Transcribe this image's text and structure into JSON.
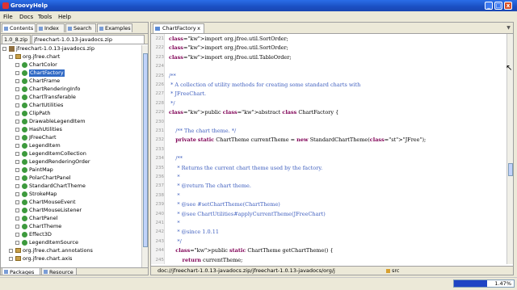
{
  "window": {
    "title": "GroovyHelp",
    "min": "_",
    "max": "□",
    "close": "x"
  },
  "menu": [
    "File",
    "Docs",
    "Tools",
    "Help"
  ],
  "left_tabs": [
    "Contents",
    "Index",
    "Search",
    "Examples"
  ],
  "doc_tabs": [
    "1.0_8.zip",
    "jfreechart-1.0.13-javadocs.zip"
  ],
  "tree": [
    {
      "label": "jfreechart-1.0.13-javadocs.zip",
      "kind": "zip",
      "level": 0
    },
    {
      "label": "org.jfree.chart",
      "kind": "pkg",
      "level": 1
    },
    {
      "label": "ChartColor",
      "kind": "cls",
      "level": 2
    },
    {
      "label": "ChartFactory",
      "kind": "cls",
      "level": 2,
      "selected": true
    },
    {
      "label": "ChartFrame",
      "kind": "cls",
      "level": 2
    },
    {
      "label": "ChartRenderingInfo",
      "kind": "cls",
      "level": 2
    },
    {
      "label": "ChartTransferable",
      "kind": "cls",
      "level": 2
    },
    {
      "label": "ChartUtilities",
      "kind": "cls",
      "level": 2
    },
    {
      "label": "ClipPath",
      "kind": "cls",
      "level": 2
    },
    {
      "label": "DrawableLegendItem",
      "kind": "cls",
      "level": 2
    },
    {
      "label": "HashUtilities",
      "kind": "cls",
      "level": 2
    },
    {
      "label": "JFreeChart",
      "kind": "cls",
      "level": 2
    },
    {
      "label": "LegendItem",
      "kind": "cls",
      "level": 2
    },
    {
      "label": "LegendItemCollection",
      "kind": "cls",
      "level": 2
    },
    {
      "label": "LegendRenderingOrder",
      "kind": "cls",
      "level": 2
    },
    {
      "label": "PaintMap",
      "kind": "cls",
      "level": 2
    },
    {
      "label": "PolarChartPanel",
      "kind": "cls",
      "level": 2
    },
    {
      "label": "StandardChartTheme",
      "kind": "cls",
      "level": 2
    },
    {
      "label": "StrokeMap",
      "kind": "cls",
      "level": 2
    },
    {
      "label": "ChartMouseEvent",
      "kind": "cls",
      "level": 2
    },
    {
      "label": "ChartMouseListener",
      "kind": "cls",
      "level": 2
    },
    {
      "label": "ChartPanel",
      "kind": "cls",
      "level": 2
    },
    {
      "label": "ChartTheme",
      "kind": "cls",
      "level": 2
    },
    {
      "label": "Effect3D",
      "kind": "cls",
      "level": 2
    },
    {
      "label": "LegendItemSource",
      "kind": "cls",
      "level": 2
    },
    {
      "label": "org.jfree.chart.annotations",
      "kind": "pkg",
      "level": 1
    },
    {
      "label": "org.jfree.chart.axis",
      "kind": "pkg",
      "level": 1
    }
  ],
  "bottom_tabs": [
    "Packages",
    "Resource"
  ],
  "editor": {
    "tab_label": "ChartFactory",
    "tab_close": "x",
    "lines": [
      {
        "n": "221",
        "t": "import org.jfree.util.SortOrder;",
        "c": "import"
      },
      {
        "n": "222",
        "t": "import org.jfree.util.SortOrder;",
        "c": "import"
      },
      {
        "n": "223",
        "t": "import org.jfree.util.TableOrder;",
        "c": "import"
      },
      {
        "n": "224",
        "t": "",
        "c": ""
      },
      {
        "n": "225",
        "t": "/**",
        "c": "cm"
      },
      {
        "n": "226",
        "t": " * A collection of utility methods for creating some standard charts with",
        "c": "cm"
      },
      {
        "n": "227",
        "t": " * JFreeChart.",
        "c": "cm"
      },
      {
        "n": "228",
        "t": " */",
        "c": "cm"
      },
      {
        "n": "229",
        "t": "public abstract class ChartFactory {",
        "c": "decl"
      },
      {
        "n": "230",
        "t": "",
        "c": ""
      },
      {
        "n": "231",
        "t": "    /** The chart theme. */",
        "c": "cm"
      },
      {
        "n": "232",
        "t": "    private static ChartTheme currentTheme = new StandardChartTheme(\"JFree\");",
        "c": "field"
      },
      {
        "n": "233",
        "t": "",
        "c": ""
      },
      {
        "n": "234",
        "t": "    /**",
        "c": "cm"
      },
      {
        "n": "235",
        "t": "     * Returns the current chart theme used by the factory.",
        "c": "cm"
      },
      {
        "n": "236",
        "t": "     *",
        "c": "cm"
      },
      {
        "n": "237",
        "t": "     * @return The chart theme.",
        "c": "cm"
      },
      {
        "n": "238",
        "t": "     *",
        "c": "cm"
      },
      {
        "n": "239",
        "t": "     * @see #setChartTheme(ChartTheme)",
        "c": "cm"
      },
      {
        "n": "240",
        "t": "     * @see ChartUtilities#applyCurrentTheme(JFreeChart)",
        "c": "cm"
      },
      {
        "n": "241",
        "t": "     *",
        "c": "cm"
      },
      {
        "n": "242",
        "t": "     * @since 1.0.11",
        "c": "cm"
      },
      {
        "n": "243",
        "t": "     */",
        "c": "cm"
      },
      {
        "n": "244",
        "t": "    public static ChartTheme getChartTheme() {",
        "c": "method"
      },
      {
        "n": "245",
        "t": "        return currentTheme;",
        "c": "ret"
      }
    ]
  },
  "breadcrumb": {
    "path": "doc://jfreechart-1.0.13-javadocs.zip/jfreechart-1.0.13-javadocs/org/j",
    "src": "src"
  },
  "status": {
    "progress_text": "1.47%",
    "progress": 0.55
  },
  "colors": {
    "selection": "#316ac5",
    "keyword": "#7f0055",
    "comment": "#3f5fbf",
    "string": "#2a00ff",
    "titlebar": "#1b4fc2"
  }
}
